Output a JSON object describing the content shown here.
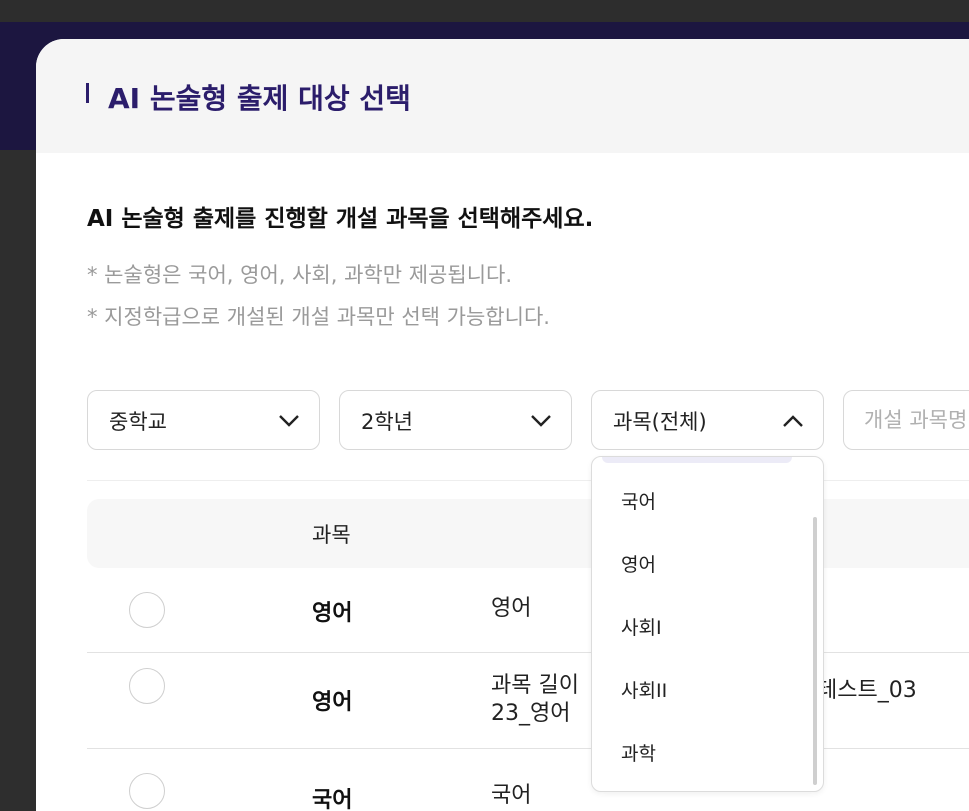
{
  "modal": {
    "title": "AI 논술형 출제 대상 선택",
    "description": "AI 논술형 출제를 진행할 개설 과목을 선택해주세요.",
    "notes": [
      "* 논술형은 국어, 영어, 사회, 과학만 제공됩니다.",
      "* 지정학급으로 개설된 개설 과목만 선택 가능합니다."
    ]
  },
  "filters": {
    "school_level": "중학교",
    "grade": "2학년",
    "subject": "과목(전체)",
    "search_placeholder": "개설 과목명"
  },
  "subject_dropdown": {
    "options": [
      "국어",
      "영어",
      "사회I",
      "사회II",
      "과학"
    ]
  },
  "table": {
    "header_subject": "과목",
    "rows": [
      {
        "subject": "영어",
        "course_lines": [
          "영어"
        ],
        "tail": ""
      },
      {
        "subject": "영어",
        "course_lines": [
          "과목 길이",
          "23_영어"
        ],
        "tail": "테스트_03"
      },
      {
        "subject": "국어",
        "course_lines": [
          "국어"
        ],
        "tail": ""
      }
    ]
  },
  "colors": {
    "title": "#2b1d6b",
    "backdrop_navy": "#1c1640",
    "header_bg": "#f5f5f5"
  }
}
